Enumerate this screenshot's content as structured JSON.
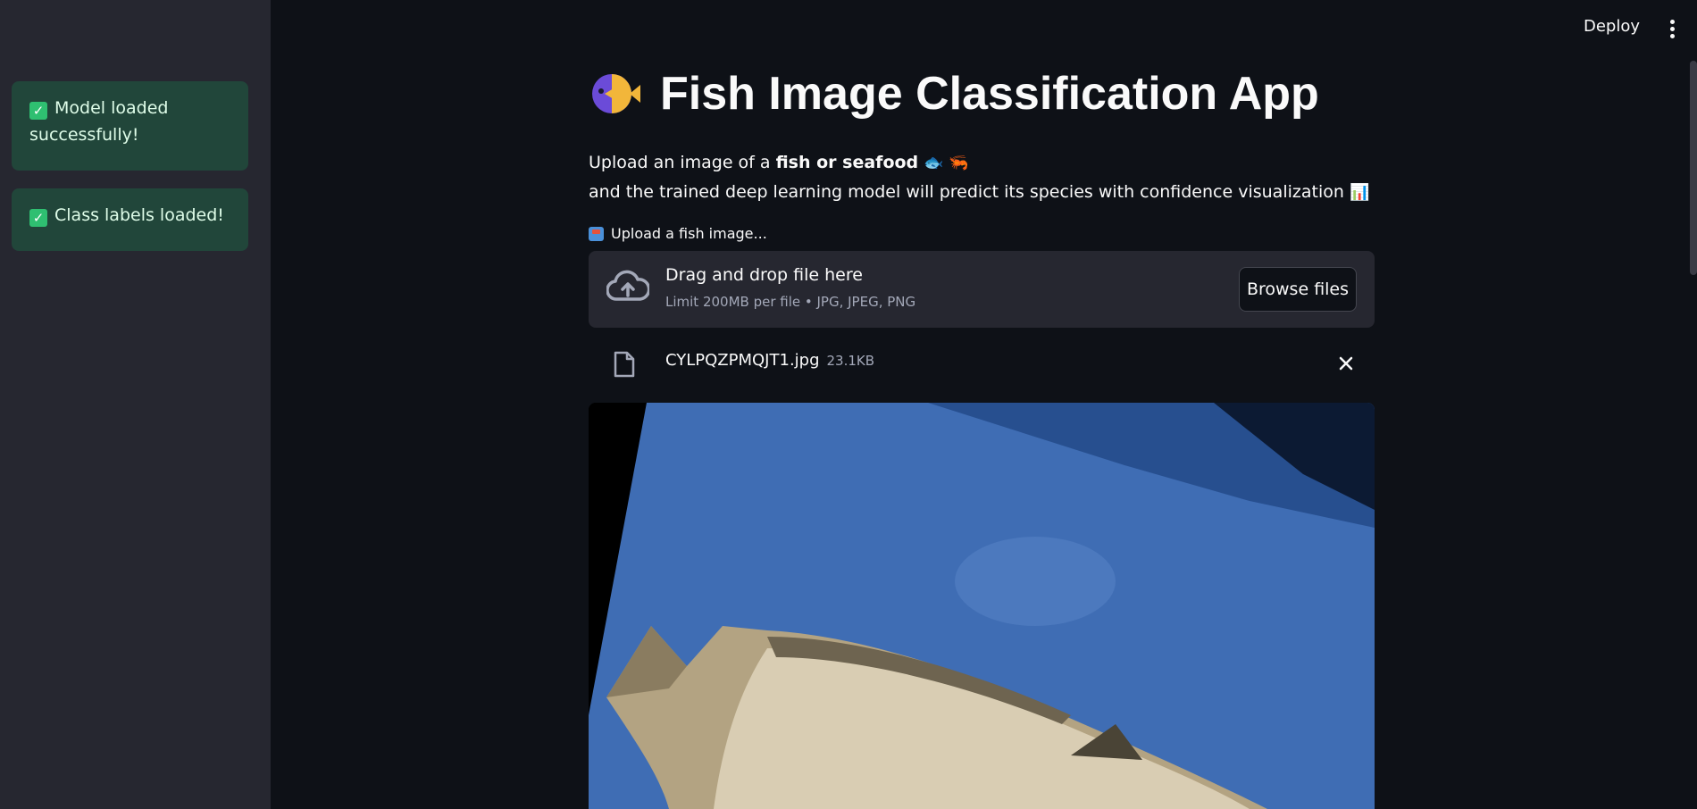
{
  "sidebar": {
    "alerts": [
      {
        "text": "Model loaded successfully!"
      },
      {
        "text": "Class labels loaded!"
      }
    ]
  },
  "topbar": {
    "deploy_label": "Deploy"
  },
  "main": {
    "title": "Fish Image Classification App",
    "description": {
      "line1_prefix": "Upload an image of a ",
      "line1_bold": "fish or seafood",
      "line1_emojis": "🐟 🦐",
      "line2": "and the trained deep learning model will predict its species with confidence visualization",
      "line2_emoji": "📊"
    },
    "uploader": {
      "label": "Upload a fish image...",
      "drop_title": "Drag and drop file here",
      "drop_sub": "Limit 200MB per file • JPG, JPEG, PNG",
      "browse_label": "Browse files"
    },
    "file": {
      "name": "CYLPQZPMQJT1.jpg",
      "size": "23.1KB"
    }
  },
  "colors": {
    "background": "#0e1117",
    "sidebar": "#262730",
    "success_bg": "#21463a",
    "success_text": "#dffde9"
  }
}
